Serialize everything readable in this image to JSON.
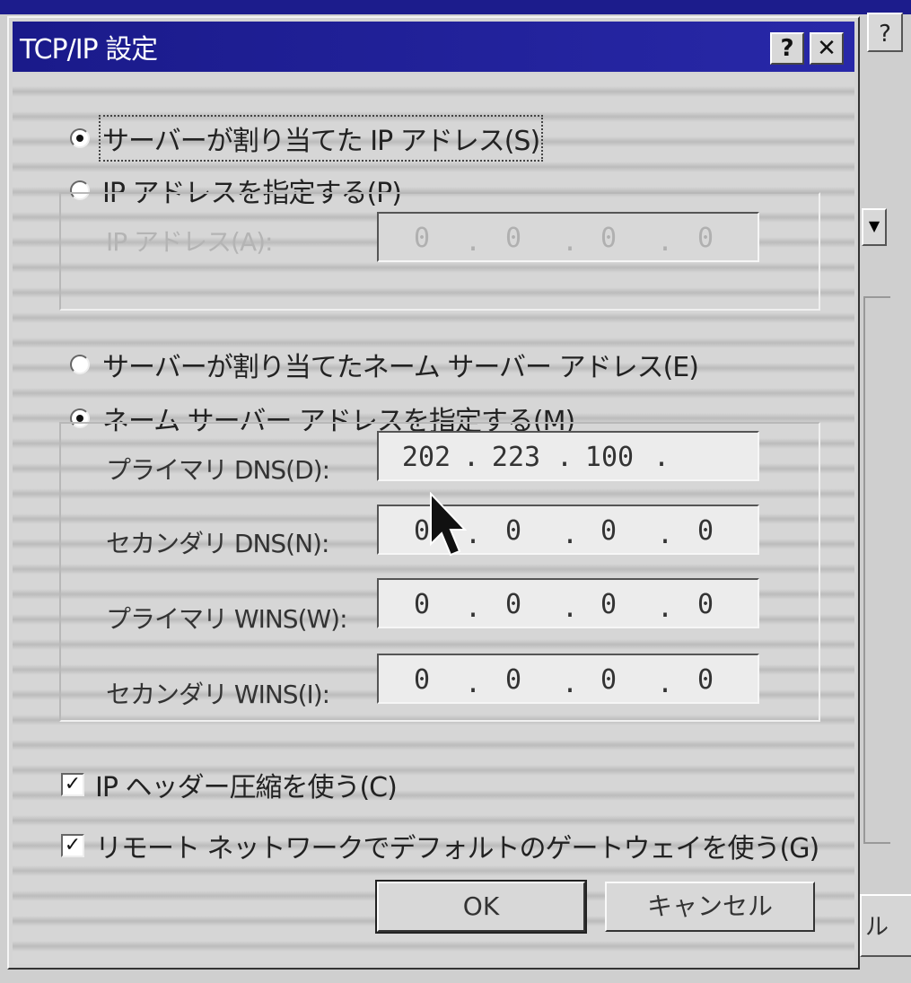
{
  "background_window": {
    "help_label": "?",
    "dropdown_arrow": "▼",
    "partial_button_label": "ル"
  },
  "dialog": {
    "title": "TCP/IP 設定",
    "help_label": "?",
    "close_label": "✕"
  },
  "ip_section": {
    "radio_server_assigned": "サーバーが割り当てた IP アドレス(S)",
    "radio_specify": "IP アドレスを指定する(P)",
    "ip_address_label": "IP アドレス(A):",
    "ip_address": [
      "0",
      "0",
      "0",
      "0"
    ]
  },
  "dns_section": {
    "radio_server_assigned": "サーバーが割り当てたネーム サーバー アドレス(E)",
    "radio_specify": "ネーム サーバー アドレスを指定する(M)",
    "primary_dns_label": "プライマリ DNS(D):",
    "primary_dns": [
      "202",
      "223",
      "100",
      ""
    ],
    "secondary_dns_label": "セカンダリ DNS(N):",
    "secondary_dns": [
      "0",
      "0",
      "0",
      "0"
    ],
    "primary_wins_label": "プライマリ WINS(W):",
    "primary_wins": [
      "0",
      "0",
      "0",
      "0"
    ],
    "secondary_wins_label": "セカンダリ WINS(I):",
    "secondary_wins": [
      "0",
      "0",
      "0",
      "0"
    ]
  },
  "options": {
    "ip_header_compression": "IP ヘッダー圧縮を使う(C)",
    "default_gateway": "リモート ネットワークでデフォルトのゲートウェイを使う(G)",
    "check_mark": "✓"
  },
  "buttons": {
    "ok": "OK",
    "cancel": "キャンセル"
  }
}
